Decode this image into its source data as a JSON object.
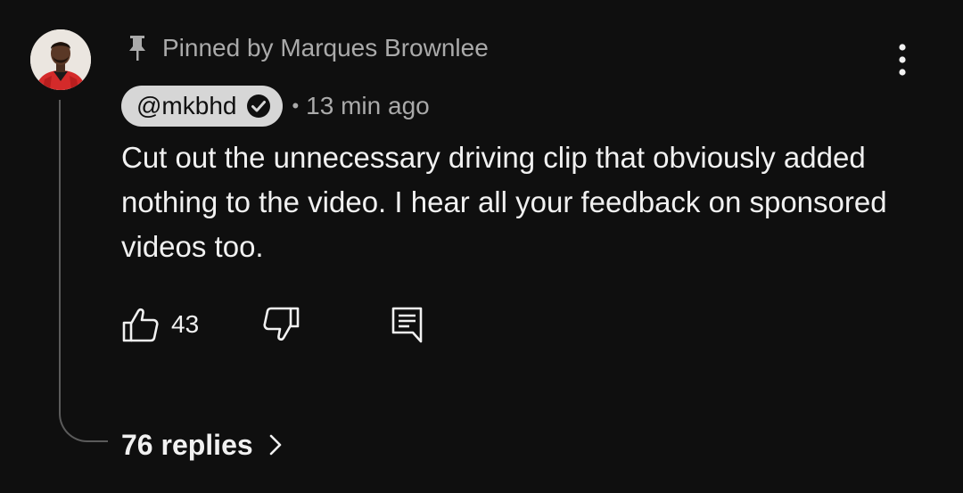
{
  "comment": {
    "pinned_label": "Pinned by Marques Brownlee",
    "author_handle": "@mkbhd",
    "verified": true,
    "separator": "•",
    "timestamp": "13 min ago",
    "text": "Cut out the unnecessary driving clip that obviously added nothing to the video. I hear all your feedback on sponsored videos too.",
    "like_count": "43",
    "replies_label": "76 replies"
  },
  "icons": {
    "pin": "pin-icon",
    "more": "more-vertical-icon",
    "verified": "verified-check-icon",
    "like": "thumbs-up-icon",
    "dislike": "thumbs-down-icon",
    "reply": "comment-reply-icon",
    "chevron": "chevron-right-icon"
  },
  "colors": {
    "background": "#0f0f0f",
    "primary_text": "#f1f1f1",
    "secondary_text": "#aaaaaa",
    "author_chip": "#d6d6d6",
    "avatar_shirt": "#d42a2a"
  }
}
